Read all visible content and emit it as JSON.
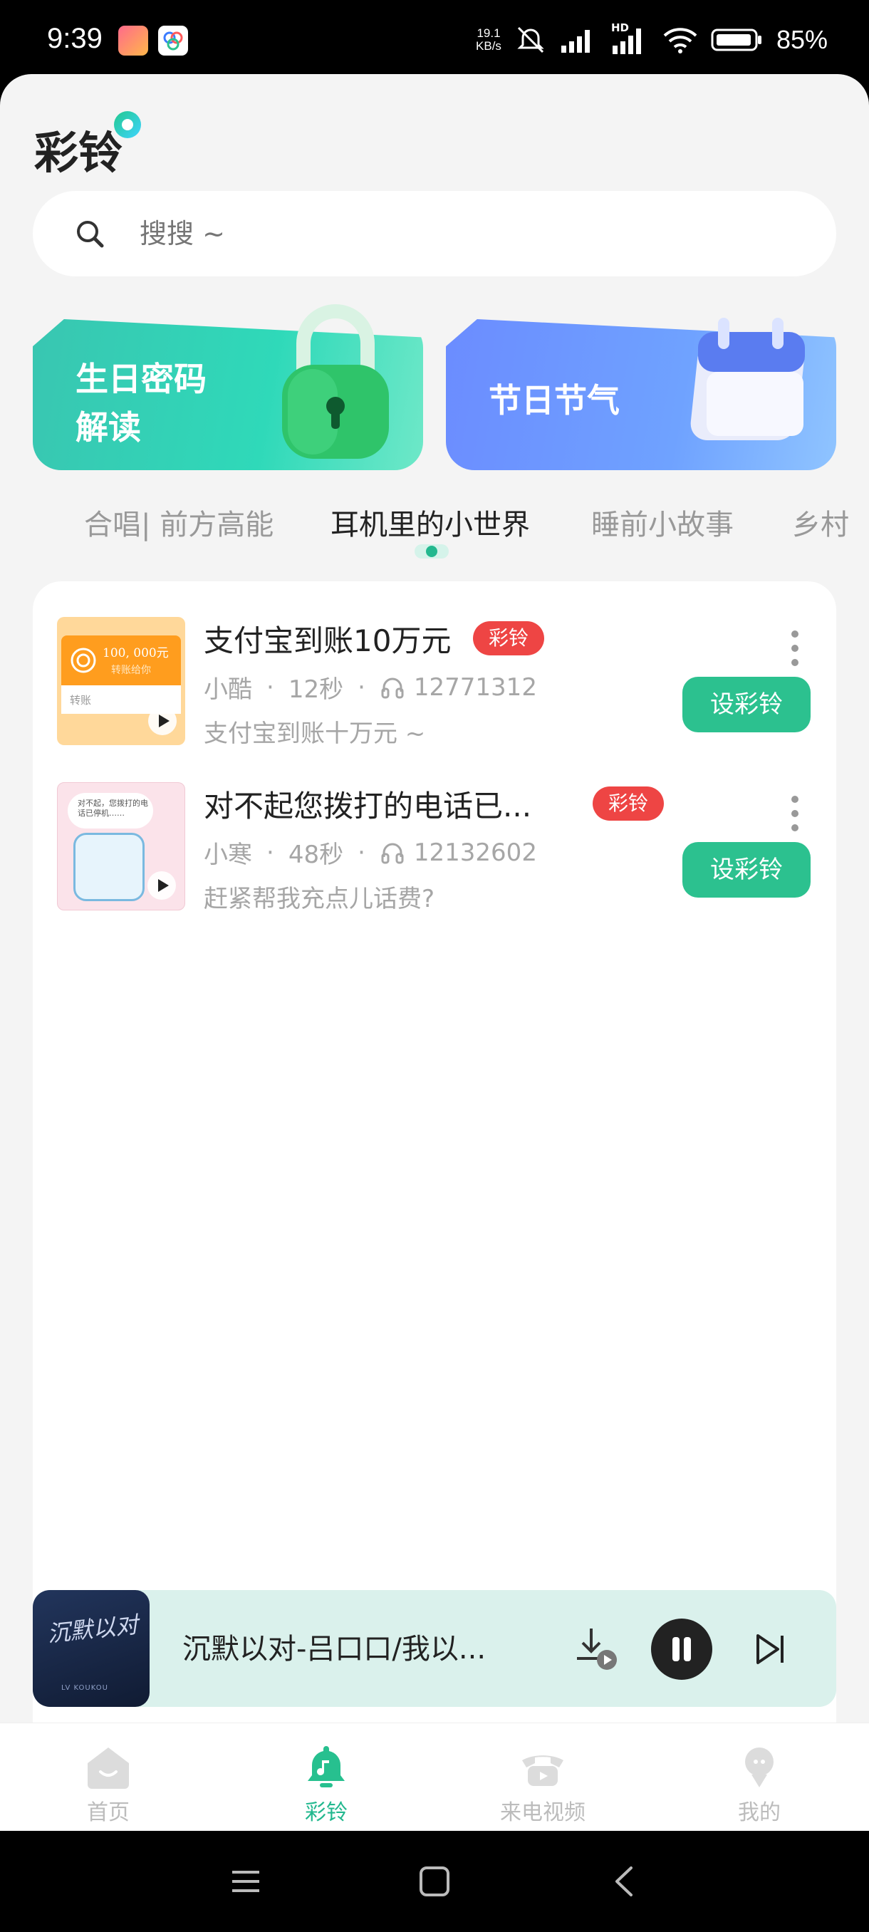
{
  "status_bar": {
    "time": "9:39",
    "net_speed_value": "19.1",
    "net_speed_unit": "KB/s",
    "battery": "85%",
    "network_label": "HD"
  },
  "page": {
    "title": "彩铃"
  },
  "search": {
    "placeholder": "搜搜 ~"
  },
  "banners": [
    {
      "line1": "生日密码",
      "line2": "解读",
      "icon": "lock-icon"
    },
    {
      "line1": "节日节气",
      "line2": "",
      "icon": "calendar-icon"
    }
  ],
  "tabs": [
    {
      "label": "合唱| 前方高能",
      "active": false
    },
    {
      "label": "耳机里的小世界",
      "active": true
    },
    {
      "label": "睡前小故事",
      "active": false
    },
    {
      "label": "乡村",
      "active": false
    }
  ],
  "ringtones": [
    {
      "title": "支付宝到账10万元",
      "tag": "彩铃",
      "author": "小酷",
      "duration": "12秒",
      "plays": "12771312",
      "desc": "支付宝到账十万元 ~",
      "button": "设彩铃",
      "thumb_amount": "100, 000元",
      "thumb_caption": "转账给你",
      "thumb_footer": "转账"
    },
    {
      "title": "对不起您拨打的电话已...",
      "tag": "彩铃",
      "author": "小寒",
      "duration": "48秒",
      "plays": "12132602",
      "desc": "赶紧帮我充点儿话费?",
      "button": "设彩铃",
      "thumb_text": "对不起，您拨打的电话已停机……"
    }
  ],
  "player": {
    "title": "沉默以对-吕口口/我以...",
    "art_text": "沉默以对",
    "art_subtext": "LV KOUKOU"
  },
  "bottom_nav": [
    {
      "label": "首页",
      "icon": "home-icon",
      "active": false
    },
    {
      "label": "彩铃",
      "icon": "bell-icon",
      "active": true
    },
    {
      "label": "来电视频",
      "icon": "phone-icon",
      "active": false
    },
    {
      "label": "我的",
      "icon": "profile-icon",
      "active": false
    }
  ],
  "colors": {
    "accent": "#2cc18f",
    "tag": "#ee4544",
    "background": "#f4f4f4",
    "player_bg": "#daf1ec"
  }
}
